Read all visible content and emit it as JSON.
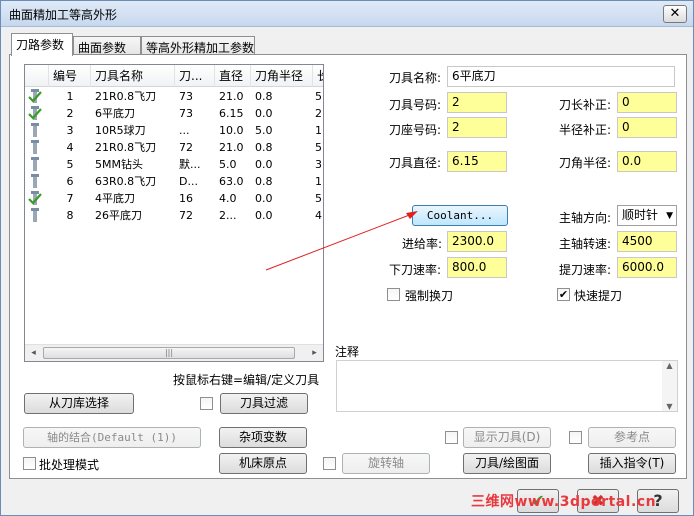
{
  "window": {
    "title": "曲面精加工等高外形",
    "close_glyph": "✕"
  },
  "tabs": [
    {
      "label": "刀路参数",
      "active": true
    },
    {
      "label": "曲面参数",
      "active": false
    },
    {
      "label": "等高外形精加工参数",
      "active": false
    }
  ],
  "tool_list": {
    "columns": [
      "编号",
      "刀具名称",
      "刀...",
      "直径",
      "刀角半径",
      "长"
    ],
    "rows": [
      {
        "icon": "selected-endmill",
        "num": "1",
        "name": "21R0.8飞刀",
        "c3": "73",
        "dia": "21.0",
        "rad": "0.8",
        "c6": "5"
      },
      {
        "icon": "selected-endmill",
        "num": "2",
        "name": "6平底刀",
        "c3": "73",
        "dia": "6.15",
        "rad": "0.0",
        "c6": "2"
      },
      {
        "icon": "endmill",
        "num": "3",
        "name": "10R5球刀",
        "c3": "...",
        "dia": "10.0",
        "rad": "5.0",
        "c6": "1"
      },
      {
        "icon": "endmill",
        "num": "4",
        "name": "21R0.8飞刀",
        "c3": "72",
        "dia": "21.0",
        "rad": "0.8",
        "c6": "5"
      },
      {
        "icon": "endmill",
        "num": "5",
        "name": "5MM钻头",
        "c3": "默...",
        "dia": "5.0",
        "rad": "0.0",
        "c6": "3"
      },
      {
        "icon": "endmill",
        "num": "6",
        "name": "63R0.8飞刀",
        "c3": "D...",
        "dia": "63.0",
        "rad": "0.8",
        "c6": "1"
      },
      {
        "icon": "selected-endmill",
        "num": "7",
        "name": "4平底刀",
        "c3": "16",
        "dia": "4.0",
        "rad": "0.0",
        "c6": "5"
      },
      {
        "icon": "endmill",
        "num": "8",
        "name": "26平底刀",
        "c3": "72",
        "dia": "2...",
        "rad": "0.0",
        "c6": "4"
      }
    ],
    "scroll_left": "◂",
    "scroll_right": "▸",
    "scroll_grip": "|||"
  },
  "hint": "按鼠标右键=编辑/定义刀具",
  "buttons": {
    "from_library": "从刀库选择",
    "tool_filter": "刀具过滤",
    "axis_combo": "轴的结合(Default (1))",
    "misc_values": "杂项变数",
    "show_tool": "显示刀具(D)",
    "ref_point": "参考点",
    "machine_origin": "机床原点",
    "rotary_axis": "旋转轴",
    "tool_plane": "刀具/绘图面",
    "insert_cmd": "插入指令(T)",
    "coolant": "Coolant..."
  },
  "batch_mode": "批处理模式",
  "form": {
    "tool_name_label": "刀具名称:",
    "tool_name_value": "6平底刀",
    "tool_no_label": "刀具号码:",
    "tool_no_value": "2",
    "len_comp_label": "刀长补正:",
    "len_comp_value": "0",
    "seat_no_label": "刀座号码:",
    "seat_no_value": "2",
    "rad_comp_label": "半径补正:",
    "rad_comp_value": "0",
    "dia_label": "刀具直径:",
    "dia_value": "6.15",
    "corner_label": "刀角半径:",
    "corner_value": "0.0",
    "spindle_dir_label": "主轴方向:",
    "spindle_dir_value": "顺时针",
    "feed_label": "进给率:",
    "feed_value": "2300.0",
    "speed_label": "主轴转速:",
    "speed_value": "4500",
    "plunge_label": "下刀速率:",
    "plunge_value": "800.0",
    "retract_label": "提刀速率:",
    "retract_value": "6000.0",
    "force_change_label": "强制换刀",
    "force_change_checked": false,
    "fast_retract_label": "快速提刀",
    "fast_retract_checked": true
  },
  "notes_label": "注释",
  "dialog_buttons": {
    "ok": "✔",
    "cancel": "✖",
    "help": "?"
  },
  "watermark": "三维网www.3dportal.cn",
  "colors": {
    "field_yellow": "#ffff99",
    "check_green": "#3a9b2a",
    "arrow_red": "#e02020"
  }
}
